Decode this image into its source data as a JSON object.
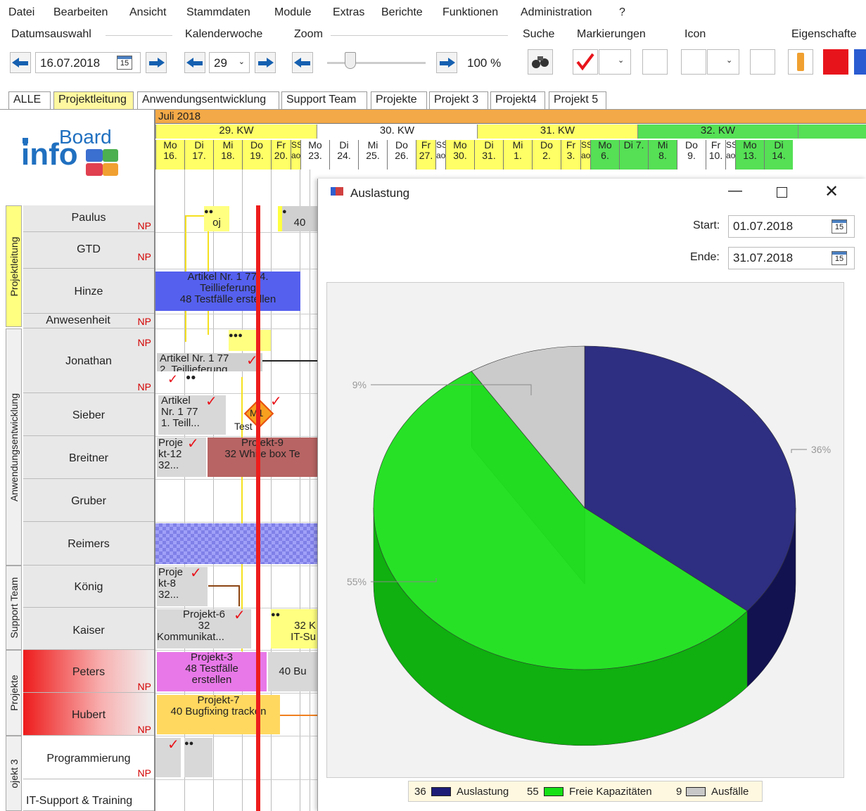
{
  "menu": [
    "Datei",
    "Bearbeiten",
    "Ansicht",
    "Stammdaten",
    "Module",
    "Extras",
    "Berichte",
    "Funktionen",
    "Administration",
    "?"
  ],
  "toolbar": {
    "datumsauswahl_label": "Datumsauswahl",
    "date_value": "16.07.2018",
    "kalenderwoche_label": "Kalenderwoche",
    "week_value": "29",
    "zoom_label": "Zoom",
    "zoom_value": "100 %",
    "suche_label": "Suche",
    "markierungen_label": "Markierungen",
    "icon_label": "Icon",
    "eigenschaften_label": "Eigenschafte",
    "calendar_day": "15",
    "colors": {
      "accent_red": "#e8141b",
      "accent_blue": "#1560b0",
      "warn": "#f0a030"
    }
  },
  "tabs": [
    "ALLE",
    "Projektleitung",
    "Anwendungsentwicklung",
    "Support Team",
    "Projekte",
    "Projekt 3",
    "Projekt4",
    "Projekt 5"
  ],
  "gantt": {
    "month": "Juli 2018",
    "weeks": [
      "29. KW",
      "30. KW",
      "31. KW",
      "32. KW"
    ],
    "days": [
      {
        "d": "Mo",
        "n": "16."
      },
      {
        "d": "Di",
        "n": "17."
      },
      {
        "d": "Mi",
        "n": "18."
      },
      {
        "d": "Do",
        "n": "19."
      },
      {
        "d": "Fr",
        "n": "20."
      },
      {
        "d": "SS",
        "n": "ao"
      },
      {
        "d": "Mo",
        "n": "23."
      },
      {
        "d": "Di",
        "n": "24."
      },
      {
        "d": "Mi",
        "n": "25."
      },
      {
        "d": "Do",
        "n": "26."
      },
      {
        "d": "Fr",
        "n": "27."
      },
      {
        "d": "SS",
        "n": "ao"
      },
      {
        "d": "Mo",
        "n": "30."
      },
      {
        "d": "Di",
        "n": "31."
      },
      {
        "d": "Mi",
        "n": "1."
      },
      {
        "d": "Do",
        "n": "2."
      },
      {
        "d": "Fr 3.",
        "n": ""
      },
      {
        "d": "SS",
        "n": "ao"
      },
      {
        "d": "Mo",
        "n": "6."
      },
      {
        "d": "Di 7.",
        "n": ""
      },
      {
        "d": "Mi",
        "n": "8."
      },
      {
        "d": "Do",
        "n": "9."
      },
      {
        "d": "Fr",
        "n": "10."
      },
      {
        "d": "SS",
        "n": "ao"
      },
      {
        "d": "Mo",
        "n": "13."
      },
      {
        "d": "Di",
        "n": "14."
      }
    ],
    "groups": [
      "Projektleitung",
      "Anwendungsentwicklung",
      "Support Team",
      "Projekte",
      "ojekt 3"
    ],
    "rows": [
      "Paulus",
      "GTD",
      "Hinze",
      "Anwesenheit",
      "Jonathan",
      "Sieber",
      "Breitner",
      "Gruber",
      "Reimers",
      "König",
      "Kaiser",
      "Peters",
      "Hubert",
      "Programmierung",
      "IT-Support & Training"
    ],
    "np": "NP",
    "bars": {
      "hinze_1": "Artikel Nr. 1 77 4.",
      "hinze_2": "Teillieferung",
      "hinze_3": "48  Testfälle erstellen",
      "jonathan_1": "Artikel Nr. 1 77",
      "jonathan_2": "2. Teillieferung",
      "sieber_1": "Artikel",
      "sieber_2": "Nr. 1 77",
      "sieber_3": "1. Teill...",
      "sieber_m": "M1",
      "sieber_t": "Test",
      "breitner_a1": "Proje",
      "breitner_a2": "kt-12",
      "breitner_a3": "32...",
      "breitner_b1": "Projekt-9",
      "breitner_b2": "32  White box Te",
      "koenig_1": "Proje",
      "koenig_2": "kt-8",
      "koenig_3": "32...",
      "kaiser_1": "Projekt-6",
      "kaiser_2": "32",
      "kaiser_3": "Kommunikat...",
      "kaiser_b1": "32  K",
      "kaiser_b2": "IT-Su",
      "peters_1": "Projekt-3",
      "peters_2": "48  Testfälle",
      "peters_3": "erstellen",
      "peters_b": "40  Bu",
      "hubert_1": "Projekt-7",
      "hubert_2": "40  Bugfixing tracken",
      "paulus_1": "oj",
      "paulus_2": "40"
    }
  },
  "dialog": {
    "title": "Auslastung",
    "start_label": "Start:",
    "start_value": "01.07.2018",
    "end_label": "Ende:",
    "end_value": "31.07.2018",
    "calendar_day": "15"
  },
  "chart_data": {
    "type": "pie",
    "title": "",
    "three_d": true,
    "slices": [
      {
        "name": "Auslastung",
        "value": 36,
        "label": "36%",
        "color": "#1d1d78"
      },
      {
        "name": "Freie Kapazitäten",
        "value": 55,
        "label": "55%",
        "color": "#16e016"
      },
      {
        "name": "Ausfälle",
        "value": 9,
        "label": "9%",
        "color": "#c8c8c8"
      }
    ],
    "legend_position": "bottom"
  }
}
